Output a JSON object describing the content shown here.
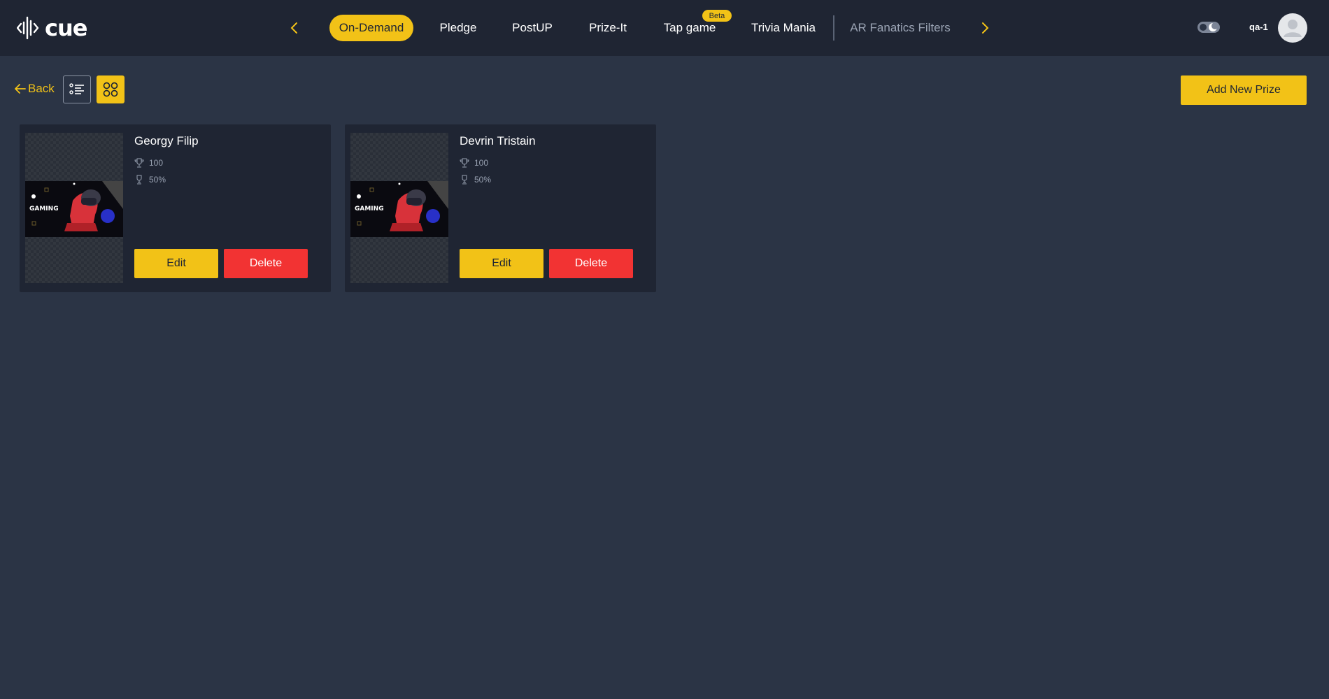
{
  "app": {
    "logo_text": "cue"
  },
  "nav": {
    "tabs": [
      {
        "label": "On-Demand"
      },
      {
        "label": "Pledge"
      },
      {
        "label": "PostUP"
      },
      {
        "label": "Prize-It"
      },
      {
        "label": "Tap game",
        "badge": "Beta"
      },
      {
        "label": "Trivia Mania"
      },
      {
        "label": "AR Fanatics Filters"
      }
    ]
  },
  "user": {
    "name": "qa-1"
  },
  "toolbar": {
    "back_label": "Back",
    "add_prize_label": "Add New Prize"
  },
  "prizes": [
    {
      "name": "Georgy Filip",
      "points": "100",
      "probability": "50%",
      "image_text": "GAMING",
      "edit_label": "Edit",
      "delete_label": "Delete"
    },
    {
      "name": "Devrin Tristain",
      "points": "100",
      "probability": "50%",
      "image_text": "GAMING",
      "edit_label": "Edit",
      "delete_label": "Delete"
    }
  ],
  "colors": {
    "accent": "#f2c217",
    "danger": "#f23333",
    "background": "#2b3445",
    "header": "#1f2533"
  }
}
